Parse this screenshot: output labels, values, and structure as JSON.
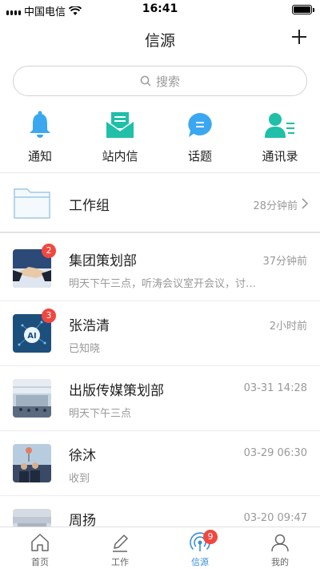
{
  "status_bar": {
    "carrier": "中国电信",
    "time": "16:41"
  },
  "header": {
    "title": "信源"
  },
  "search": {
    "placeholder": "搜索"
  },
  "shortcuts": [
    {
      "label": "通知",
      "icon": "bell-icon",
      "color": "#3aa8f0"
    },
    {
      "label": "站内信",
      "icon": "envelope-icon",
      "color": "#1fbfa8"
    },
    {
      "label": "话题",
      "icon": "chat-bubble-icon",
      "color": "#3aa8f0"
    },
    {
      "label": "通讯录",
      "icon": "contacts-icon",
      "color": "#1fbfa8"
    }
  ],
  "folder": {
    "name": "工作组",
    "time": "28分钟前"
  },
  "chats": [
    {
      "name": "集团策划部",
      "time": "37分钟前",
      "message": "明天下午三点，听涛会议室开会议，讨…",
      "badge": "2",
      "avatar": "handshake"
    },
    {
      "name": "张浩清",
      "time": "2小时前",
      "message": "已知晓",
      "badge": "3",
      "avatar": "ai"
    },
    {
      "name": "出版传媒策划部",
      "time": "03-31 14:28",
      "message": "明天下午三点",
      "badge": "",
      "avatar": "hall"
    },
    {
      "name": "徐沐",
      "time": "03-29 06:30",
      "message": "收到",
      "badge": "",
      "avatar": "people"
    },
    {
      "name": "周扬",
      "time": "03-20 09:47",
      "message": "",
      "badge": "",
      "avatar": "crowd"
    }
  ],
  "tabs": [
    {
      "label": "首页",
      "icon": "home-icon"
    },
    {
      "label": "工作",
      "icon": "pen-icon"
    },
    {
      "label": "信源",
      "icon": "signal-icon",
      "badge": "9"
    },
    {
      "label": "我的",
      "icon": "user-icon"
    }
  ],
  "colors": {
    "accent": "#3a8fd8",
    "badge": "#f0473f",
    "teal": "#1fbfa8",
    "blue": "#3aa8f0"
  }
}
